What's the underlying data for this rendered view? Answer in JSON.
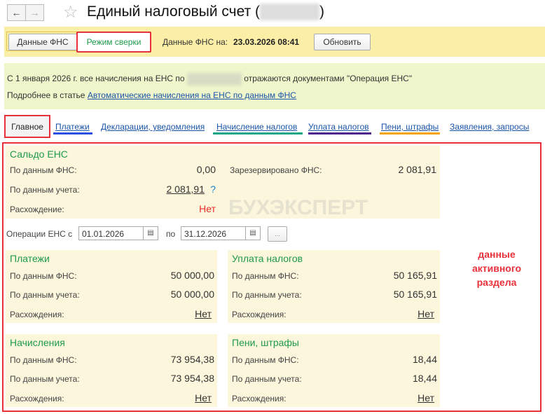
{
  "header": {
    "title": "Единый налоговый счет (",
    "title_close": ")"
  },
  "toolbar": {
    "fns_data_button": "Данные ФНС",
    "reconcile_button": "Режим сверки",
    "fns_date_label": "Данные ФНС на:",
    "fns_date_value": "23.03.2026 08:41",
    "refresh_button": "Обновить"
  },
  "info": {
    "line1_a": "С 1 января 2026 г. все начисления на ЕНС по",
    "line1_b": "отражаются документами \"Операция ЕНС\"",
    "line2_prefix": "Подробнее в статье",
    "line2_link": "Автоматические начисления на ЕНС по данным ФНС"
  },
  "tabs": [
    {
      "label": "Главное"
    },
    {
      "label": "Платежи",
      "color": "#2b4fe0"
    },
    {
      "label": "Декларации, уведомления"
    },
    {
      "label": "Начисление налогов",
      "color": "#12a586"
    },
    {
      "label": "Уплата налогов",
      "color": "#4b1c8c"
    },
    {
      "label": "Пени, штрафы",
      "color": "#f5a300"
    },
    {
      "label": "Заявления, запросы"
    }
  ],
  "saldo": {
    "title": "Сальдо ЕНС",
    "fns_label": "По данным ФНС:",
    "fns_value": "0,00",
    "reserved_label": "Зарезервировано ФНС:",
    "reserved_value": "2 081,91",
    "acc_label": "По данным учета:",
    "acc_value": "2 081,91",
    "help": "?",
    "diff_label": "Расхождение:",
    "diff_value": "Нет"
  },
  "watermark": "БУХЭКСПЕРТ",
  "period": {
    "label": "Операции ЕНС с",
    "from": "01.01.2026",
    "to_label": "по",
    "to": "31.12.2026",
    "more": "..."
  },
  "panels": [
    {
      "title": "Платежи",
      "fns_label": "По данным ФНС:",
      "fns": "50 000,00",
      "acc_label": "По данным учета:",
      "acc": "50 000,00",
      "diff_label": "Расхождения:",
      "diff": "Нет"
    },
    {
      "title": "Уплата налогов",
      "fns_label": "По данным ФНС:",
      "fns": "50 165,91",
      "acc_label": "По данным учета:",
      "acc": "50 165,91",
      "diff_label": "Расхождения:",
      "diff": "Нет"
    },
    {
      "title": "Начисления",
      "fns_label": "По данным ФНС:",
      "fns": "73 954,38",
      "acc_label": "По данным учета:",
      "acc": "73 954,38",
      "diff_label": "Расхождения:",
      "diff": "Нет"
    },
    {
      "title": "Пени, штрафы",
      "fns_label": "По данным ФНС:",
      "fns": "18,44",
      "acc_label": "По данным учета:",
      "acc": "18,44",
      "diff_label": "Расхождения:",
      "diff": "Нет"
    }
  ],
  "annotation": "данные активного раздела",
  "colors": {
    "highlight": "#e8313a",
    "green": "#1f9a4a",
    "link": "#1a55a8"
  }
}
